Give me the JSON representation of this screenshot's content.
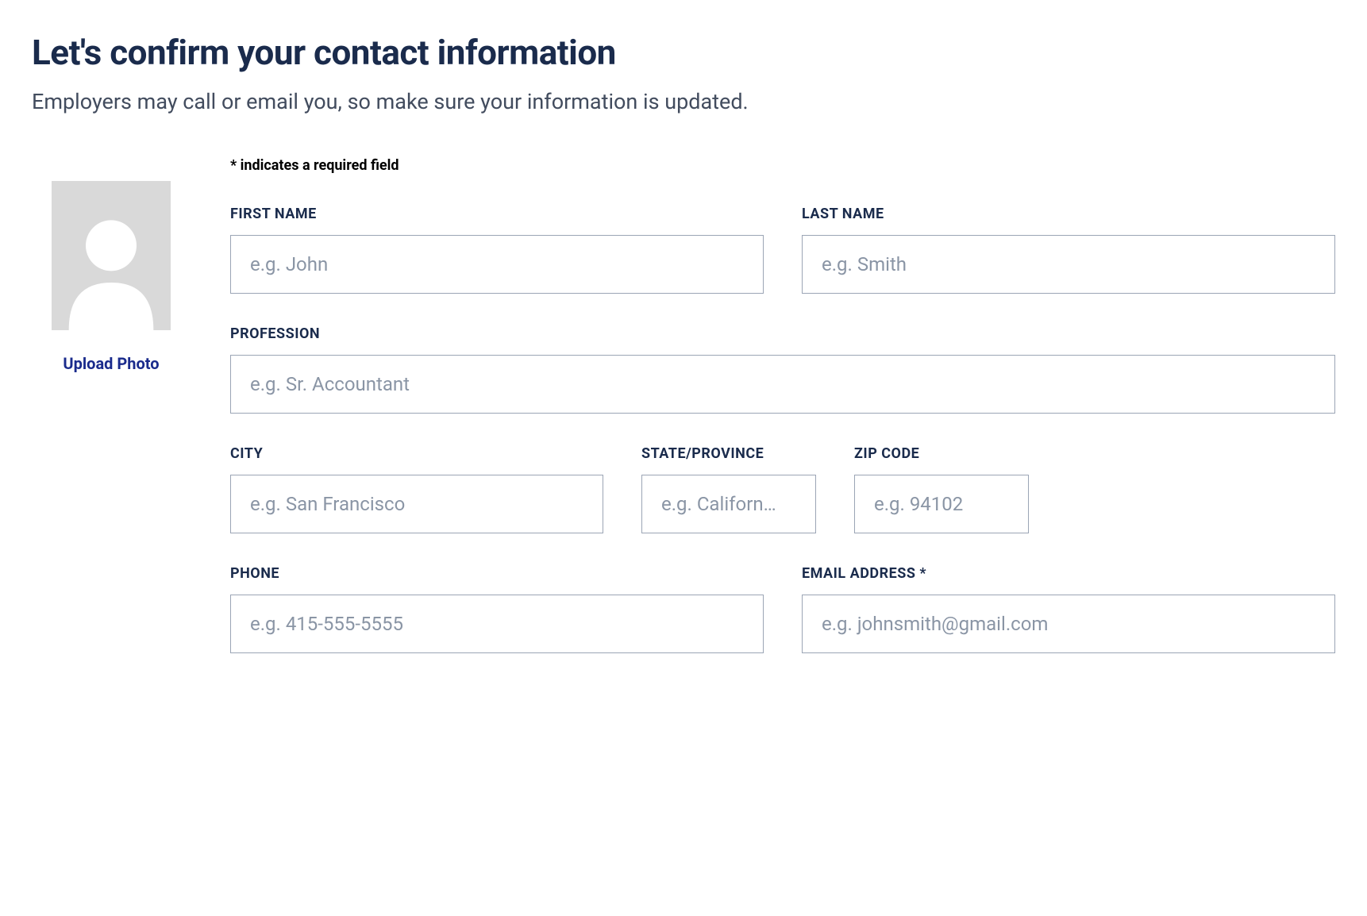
{
  "header": {
    "title": "Let's confirm your contact information",
    "subtitle": "Employers may call or email you, so make sure your information is updated."
  },
  "photo": {
    "upload_label": "Upload Photo"
  },
  "form": {
    "required_note": "* indicates a required field",
    "first_name": {
      "label": "FIRST NAME",
      "placeholder": "e.g. John",
      "value": ""
    },
    "last_name": {
      "label": "LAST NAME",
      "placeholder": "e.g. Smith",
      "value": ""
    },
    "profession": {
      "label": "PROFESSION",
      "placeholder": "e.g. Sr. Accountant",
      "value": ""
    },
    "city": {
      "label": "CITY",
      "placeholder": "e.g. San Francisco",
      "value": ""
    },
    "state": {
      "label": "STATE/PROVINCE",
      "placeholder": "e.g. Californ…",
      "value": ""
    },
    "zip": {
      "label": "ZIP CODE",
      "placeholder": "e.g. 94102",
      "value": ""
    },
    "phone": {
      "label": "PHONE",
      "placeholder": "e.g. 415-555-5555",
      "value": ""
    },
    "email": {
      "label": "EMAIL ADDRESS *",
      "placeholder": "e.g. johnsmith@gmail.com",
      "value": ""
    }
  }
}
